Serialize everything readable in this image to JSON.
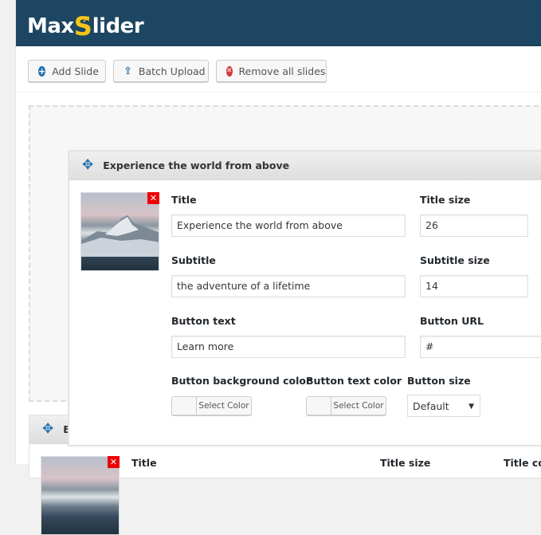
{
  "app": {
    "logo_part1": "Max",
    "logo_s": "S",
    "logo_part2": "lider"
  },
  "toolbar": {
    "add_slide": "Add Slide",
    "batch_upload": "Batch Upload",
    "remove_all": "Remove all slides"
  },
  "slides": [
    {
      "heading": "Experience the world from above",
      "delete_glyph": "✕",
      "fields": {
        "title_label": "Title",
        "title_value": "Experience the world from above",
        "title_size_label": "Title size",
        "title_size_value": "26",
        "subtitle_label": "Subtitle",
        "subtitle_value": "the adventure of a lifetime",
        "subtitle_size_label": "Subtitle size",
        "subtitle_size_value": "14",
        "button_text_label": "Button text",
        "button_text_value": "Learn more",
        "button_url_label": "Button URL",
        "button_url_value": "#",
        "button_bg_color_label": "Button background color",
        "button_text_color_label": "Button text color",
        "button_size_label": "Button size",
        "select_color": "Select Color",
        "button_size_value": "Default"
      }
    },
    {
      "heading": "E",
      "delete_glyph": "✕",
      "fields": {
        "title_label": "Title",
        "title_size_label": "Title size",
        "title_color_label": "Title co"
      }
    }
  ],
  "icons": {
    "move": "✥",
    "add": "+",
    "upload": "⇪",
    "remove": "✕",
    "caret": "▼"
  }
}
